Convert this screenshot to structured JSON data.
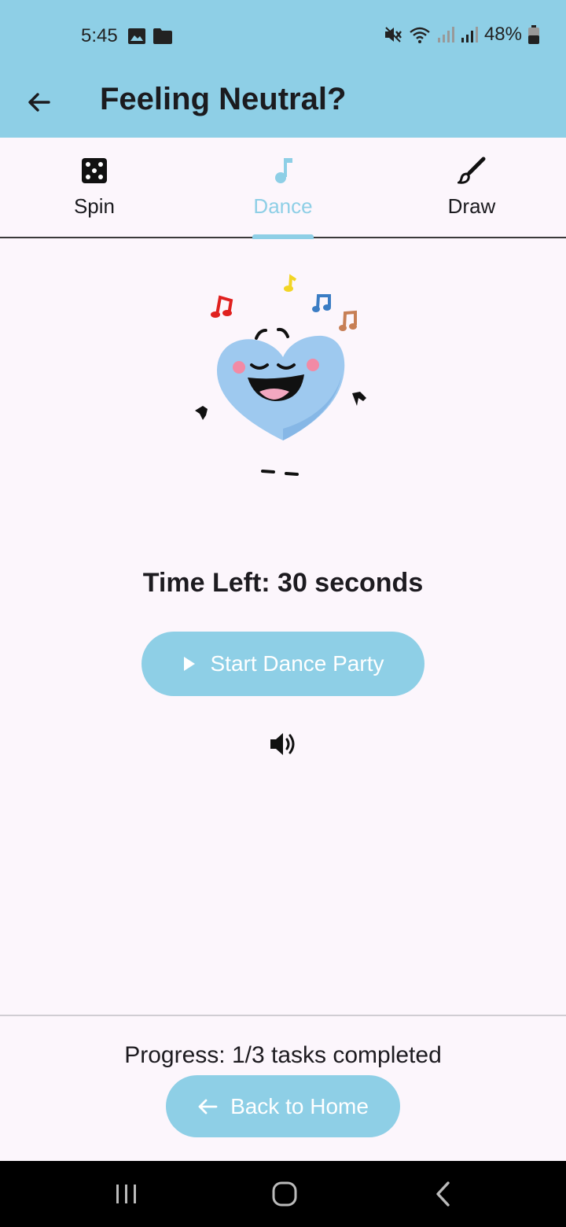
{
  "status_bar": {
    "time": "5:45",
    "battery": "48%",
    "left_icons": [
      "image-icon",
      "folder-icon"
    ],
    "right_icons": [
      "mute-icon",
      "wifi-icon",
      "signal-icon",
      "signal-icon",
      "battery-icon"
    ]
  },
  "app_bar": {
    "title": "Feeling Neutral?",
    "back_icon": "arrow-left-icon"
  },
  "tabs": [
    {
      "label": "Spin",
      "icon": "dice-icon",
      "active": false
    },
    {
      "label": "Dance",
      "icon": "music-note-icon",
      "active": true
    },
    {
      "label": "Draw",
      "icon": "brush-icon",
      "active": false
    }
  ],
  "dance": {
    "time_left": "Time Left: 30 seconds",
    "start_button": "Start Dance Party",
    "start_icon": "play-icon",
    "volume_icon": "volume-icon"
  },
  "footer": {
    "progress": "Progress: 1/3 tasks completed",
    "home_button": "Back to Home",
    "home_icon": "arrow-left-icon"
  },
  "nav_bar": {
    "buttons": [
      "recents-icon",
      "home-icon",
      "back-icon"
    ]
  },
  "colors": {
    "accent": "#8ecfe6",
    "background": "#fcf6fc",
    "text": "#1d1b20"
  }
}
